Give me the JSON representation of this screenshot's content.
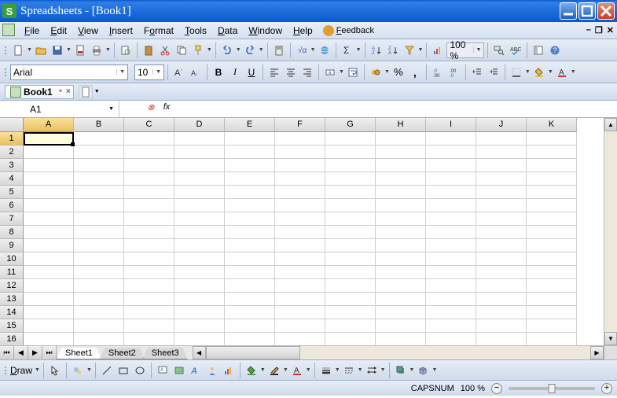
{
  "titlebar": {
    "title": "Spreadsheets - [Book1]"
  },
  "menus": {
    "file": "File",
    "edit": "Edit",
    "view": "View",
    "insert": "Insert",
    "format": "Format",
    "tools": "Tools",
    "data": "Data",
    "window": "Window",
    "help": "Help",
    "feedback": "Feedback"
  },
  "toolbar1": {
    "zoom": "100 %"
  },
  "toolbar2": {
    "font": "Arial",
    "size": "10"
  },
  "docs": {
    "book1": "Book1"
  },
  "cellref": {
    "value": "A1",
    "fx": "fx"
  },
  "columns": [
    "A",
    "B",
    "C",
    "D",
    "E",
    "F",
    "G",
    "H",
    "I",
    "J",
    "K"
  ],
  "rows": [
    "1",
    "2",
    "3",
    "4",
    "5",
    "6",
    "7",
    "8",
    "9",
    "10",
    "11",
    "12",
    "13",
    "14",
    "15",
    "16"
  ],
  "sheets": {
    "s1": "Sheet1",
    "s2": "Sheet2",
    "s3": "Sheet3"
  },
  "draw": {
    "label": "Draw"
  },
  "status": {
    "caps": "CAPS",
    "num": "NUM",
    "zoom": "100 %"
  }
}
